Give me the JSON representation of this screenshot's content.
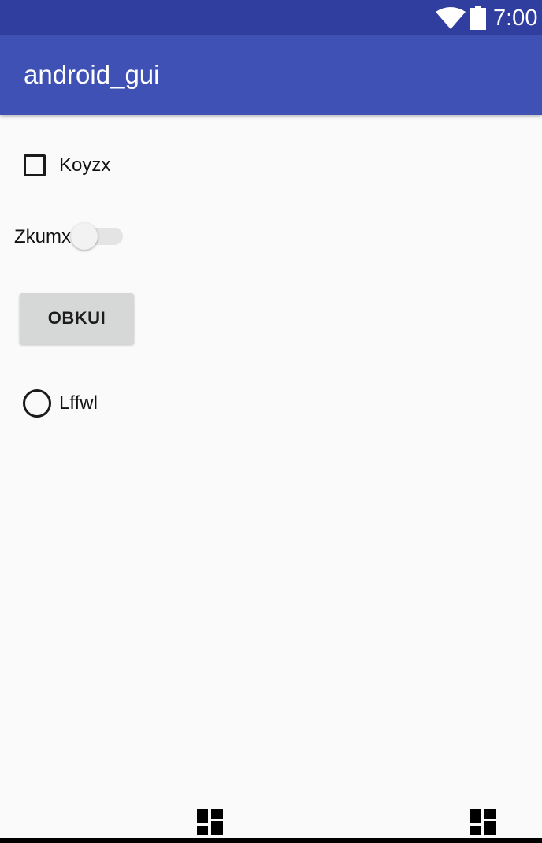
{
  "status_bar": {
    "time": "7:00",
    "icons": [
      "wifi-icon",
      "battery-icon"
    ],
    "background_color": "#303f9f"
  },
  "app_bar": {
    "title": "android_gui",
    "background_color": "#3f51b5"
  },
  "form": {
    "checkbox": {
      "label": "Koyzx",
      "checked": false
    },
    "switch": {
      "label": "Zkumx",
      "on": false
    },
    "button": {
      "label": "OBKUI"
    },
    "radio": {
      "label": "Lffwl",
      "selected": false
    }
  },
  "bottom_nav": {
    "icons": [
      "grid-icon",
      "grid-icon"
    ]
  }
}
